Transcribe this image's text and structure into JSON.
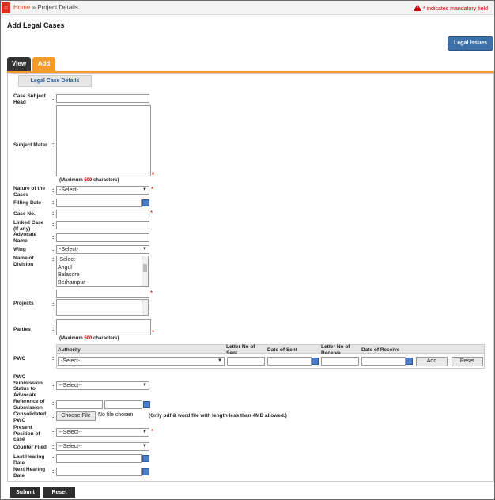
{
  "header": {
    "home": "Home",
    "sep": "»",
    "current": "Project Details",
    "mandatory_note": "* indicates mandatory field"
  },
  "page_title": "Add Legal Cases",
  "legal_issues_button": "Legal Issues",
  "tabs": {
    "view": "View",
    "add": "Add"
  },
  "subtab": "Legal Case Details",
  "fields": {
    "case_subject_head": "Case Subject Head",
    "subject_mater": "Subject Mater",
    "nature_of_cases": "Nature of the Cases",
    "filling_date": "Filling Date",
    "case_no": "Case No.",
    "linked_case": "Linked Case (If any)",
    "advocate_name": "Advocate Name",
    "wing": "Wing",
    "name_of_division": "Name of Division",
    "projects": "Projects",
    "parties": "Parties",
    "pwc": "PWC",
    "pwc_submission": "PWC Submission Status to Advocate",
    "reference_submission": "Reference of Submission",
    "consolidated_pwc": "Consolidated PWC",
    "present_position": "Present Position of case",
    "counter_filed": "Counter Filed",
    "last_hearing": "Last Hearing Date",
    "next_hearing": "Next Hearing Date"
  },
  "note": {
    "prefix": "(Maximum ",
    "num": "500",
    "suffix": " characters)"
  },
  "selects": {
    "select": "-Select-",
    "select2": "--Select--"
  },
  "division_options": [
    "-Select-",
    "Angul",
    "Balasore",
    "Berhampur"
  ],
  "pwc_table": {
    "authority": "Authority",
    "letter_sent": "Letter No of Sent",
    "date_sent": "Date of Sent",
    "letter_receive": "Letter No of Receive",
    "date_receive": "Date of Receive",
    "add": "Add",
    "reset": "Reset"
  },
  "file": {
    "button": "Choose File",
    "status": "No file chosen",
    "hint": "(Only pdf & word file with length less than 4MB allowed.)"
  },
  "footer": {
    "submit": "Submit",
    "reset": "Reset"
  },
  "colors": {
    "accent": "#f39b2b",
    "primary": "#3d6fa8",
    "required": "#cc0000"
  }
}
